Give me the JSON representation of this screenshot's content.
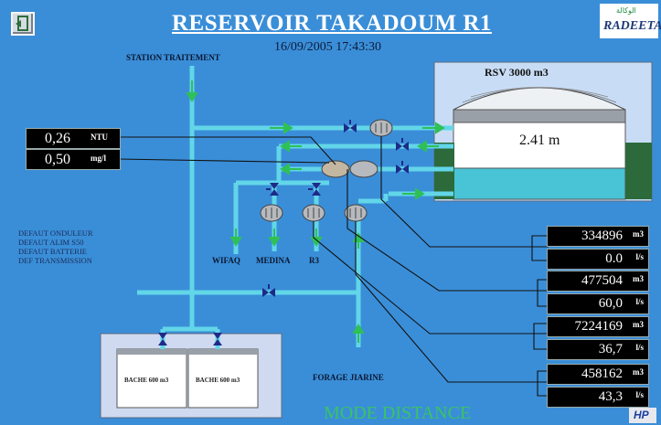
{
  "title": "RESERVOIR TAKADOUM R1",
  "datetime": "16/09/2005 17:43:30",
  "labels": {
    "station": "STATION TRAITEMENT",
    "wifaq": "WIFAQ",
    "medina": "MEDINA",
    "r3": "R3",
    "forage": "FORAGE JIARINE",
    "rsv": "RSV 3000 m3",
    "bache1": "BACHE 600 m3",
    "bache2": "BACHE 600 m3"
  },
  "alarms": [
    "DEFAUT ONDULEUR",
    "DEFAUT ALIM S50",
    "DEFAUT BATTERIE",
    "DEF TRANSMISSION"
  ],
  "tank_level": "2.41 m",
  "quality": [
    {
      "value": "0,26",
      "unit": "NTU"
    },
    {
      "value": "0,50",
      "unit": "mg/l"
    }
  ],
  "meters": [
    {
      "volume": "334896",
      "volume_unit": "m3",
      "flow": "0.0",
      "flow_unit": "l/s"
    },
    {
      "volume": "477504",
      "volume_unit": "m3",
      "flow": "60,0",
      "flow_unit": "l/s"
    },
    {
      "volume": "7224169",
      "volume_unit": "m3",
      "flow": "36,7",
      "flow_unit": "l/s"
    },
    {
      "volume": "458162",
      "volume_unit": "m3",
      "flow": "43,3",
      "flow_unit": "l/s"
    }
  ],
  "mode": "MODE DISTANCE",
  "logo": {
    "text": "RADEETA",
    "arabic": "الوكالة"
  },
  "vendor_logo": "HP",
  "colors": {
    "background": "#3a8ed8",
    "pipe": "#62d6e8",
    "flow_arrow": "#2fc056",
    "valve": "#1e2a8a",
    "display": "#000000"
  }
}
